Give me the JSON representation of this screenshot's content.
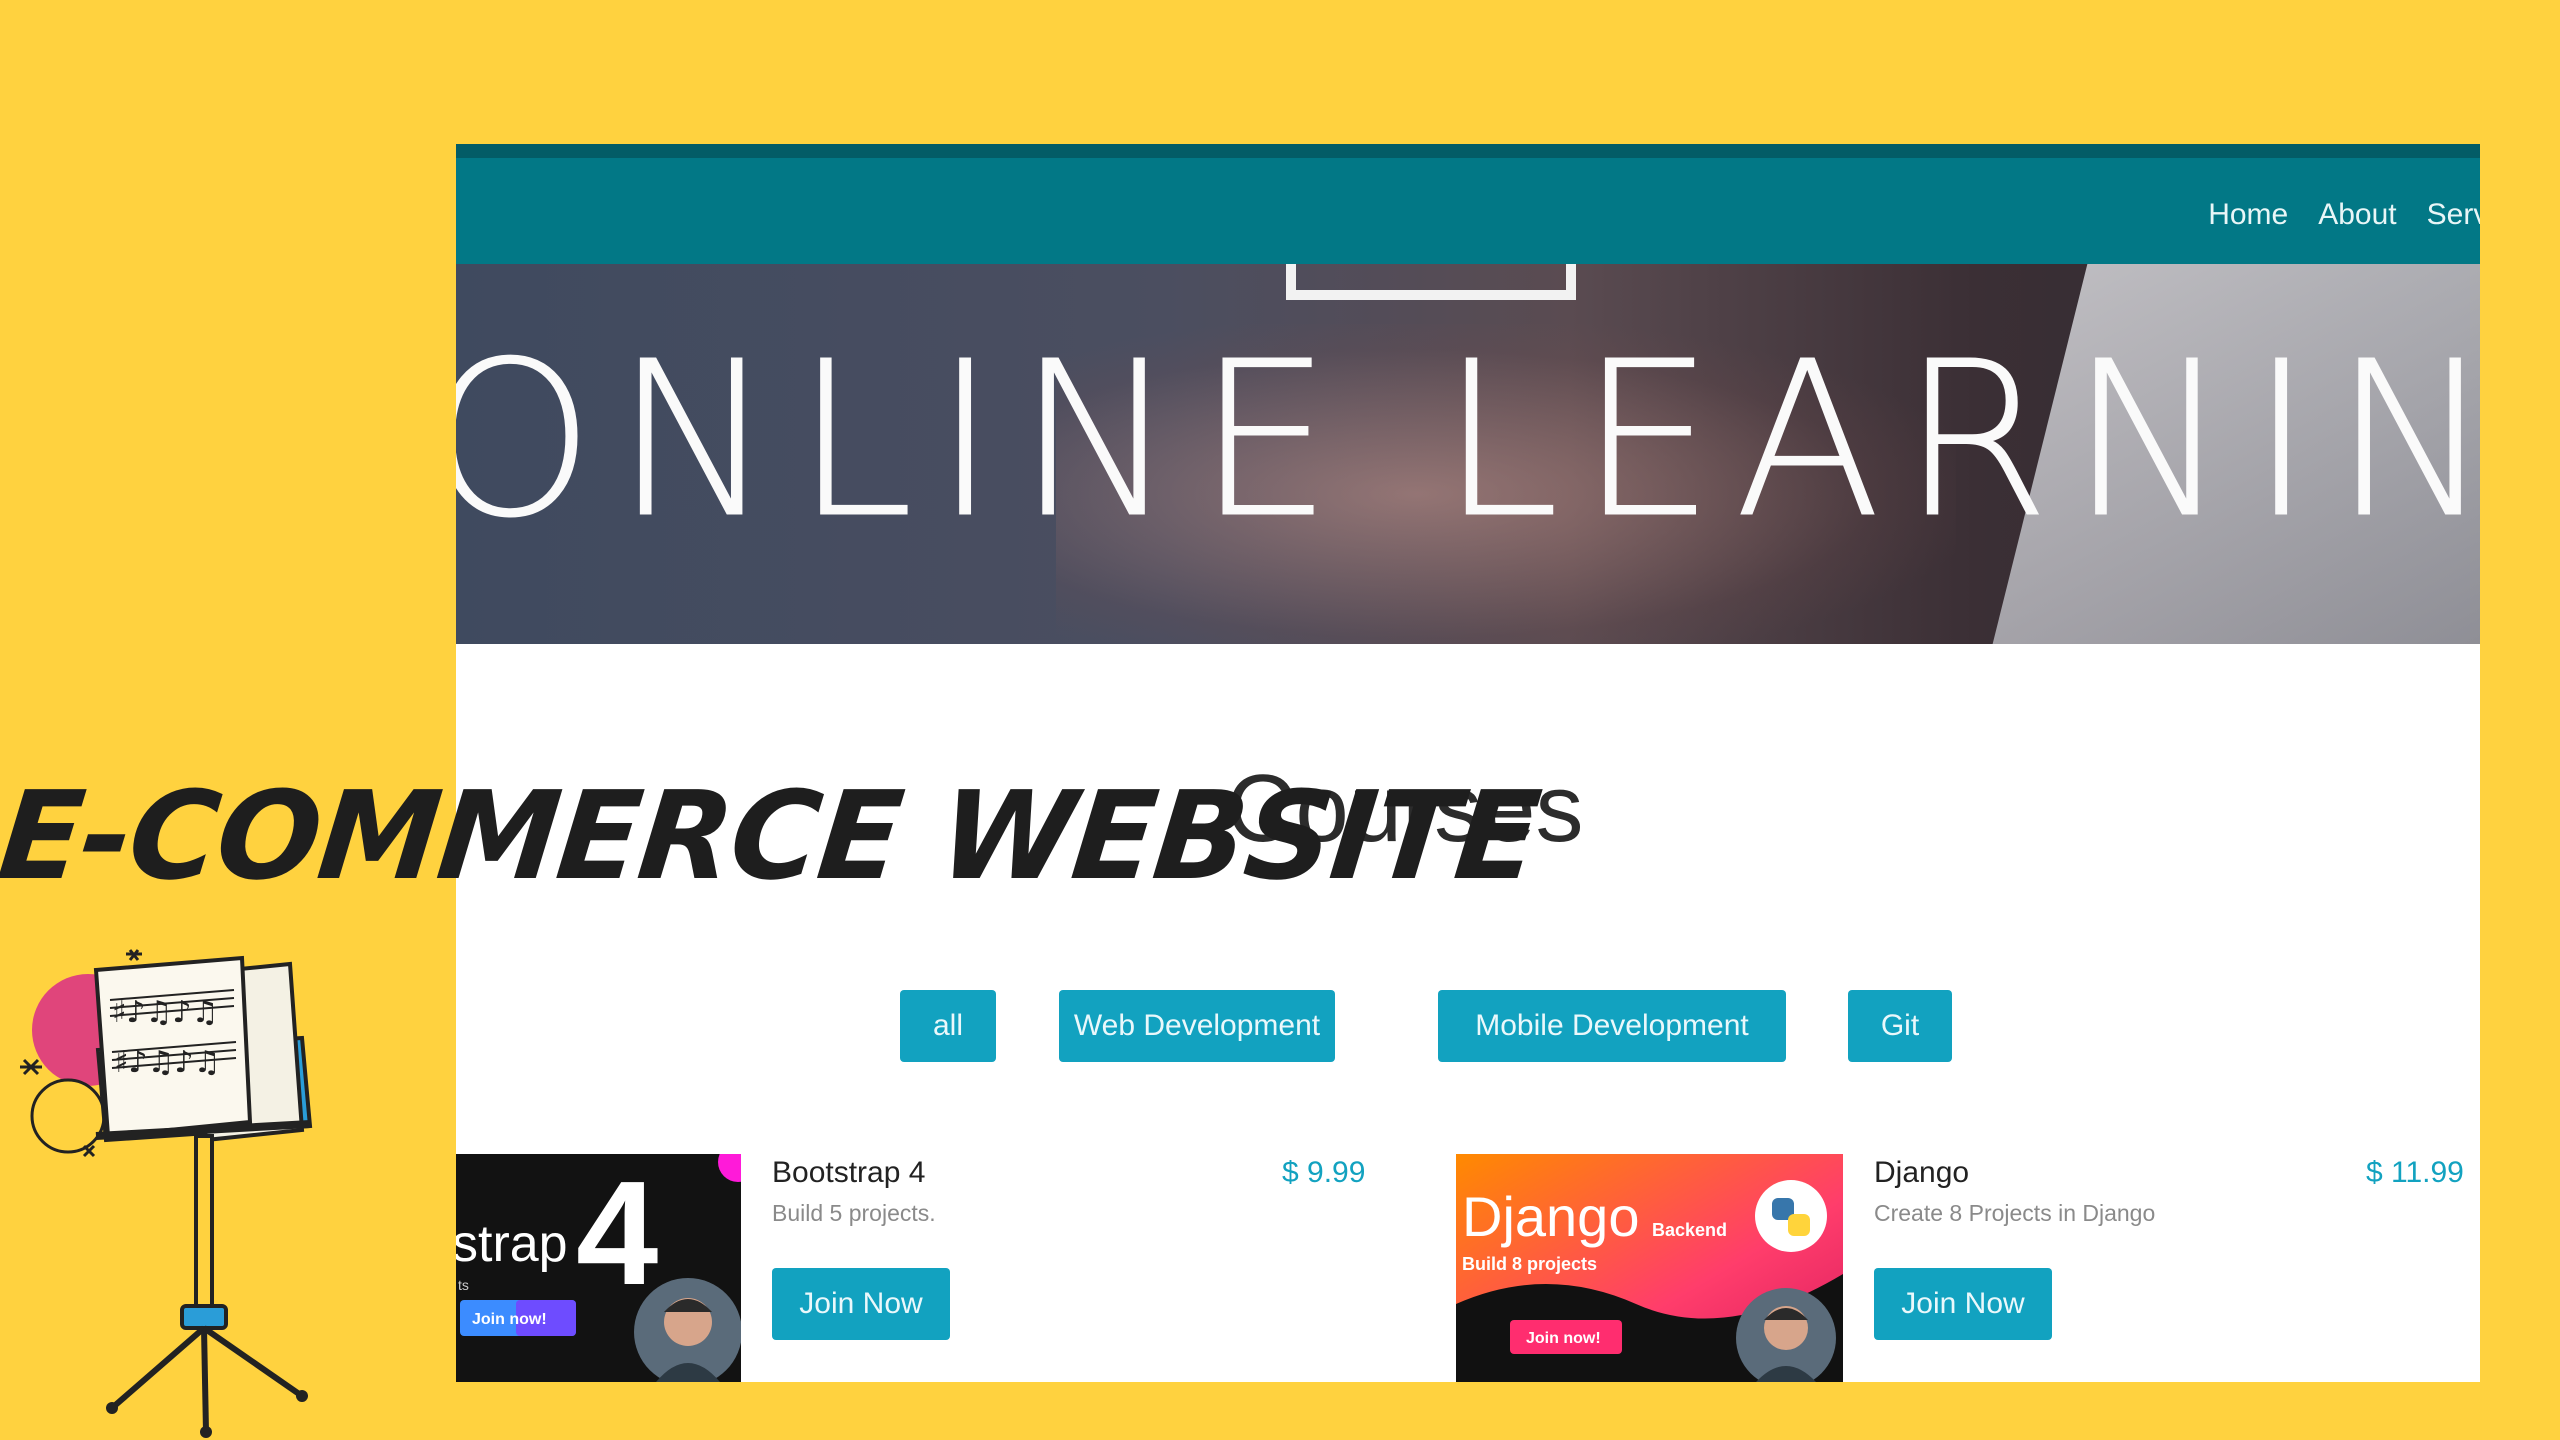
{
  "overlay_title": "E-COMMERCE WEBSITE",
  "nav": {
    "items": [
      "Home",
      "About",
      "Servic"
    ]
  },
  "hero": {
    "title": "ONLINE LEARNING"
  },
  "courses_title": "Courses",
  "filters": [
    "all",
    "Web Development",
    "Mobile Development",
    "Git"
  ],
  "courses": [
    {
      "name": "Bootstrap 4",
      "desc": "Build 5 projects.",
      "price": "$ 9.99",
      "button": "Join Now",
      "thumb": {
        "big": "4",
        "word": "strap",
        "sub": "ts",
        "pill": "Join now!"
      }
    },
    {
      "name": "Django",
      "desc": "Create 8 Projects in Django",
      "price": "$ 11.99",
      "button": "Join Now",
      "thumb": {
        "title": "Django",
        "tag": "Backend",
        "sub": "Build 8 projects",
        "pill": "Join now!"
      }
    }
  ],
  "colors": {
    "page_bg": "#FFD23F",
    "navbar": "#027886",
    "accent": "#12A2C0",
    "price": "#12A2C0"
  }
}
